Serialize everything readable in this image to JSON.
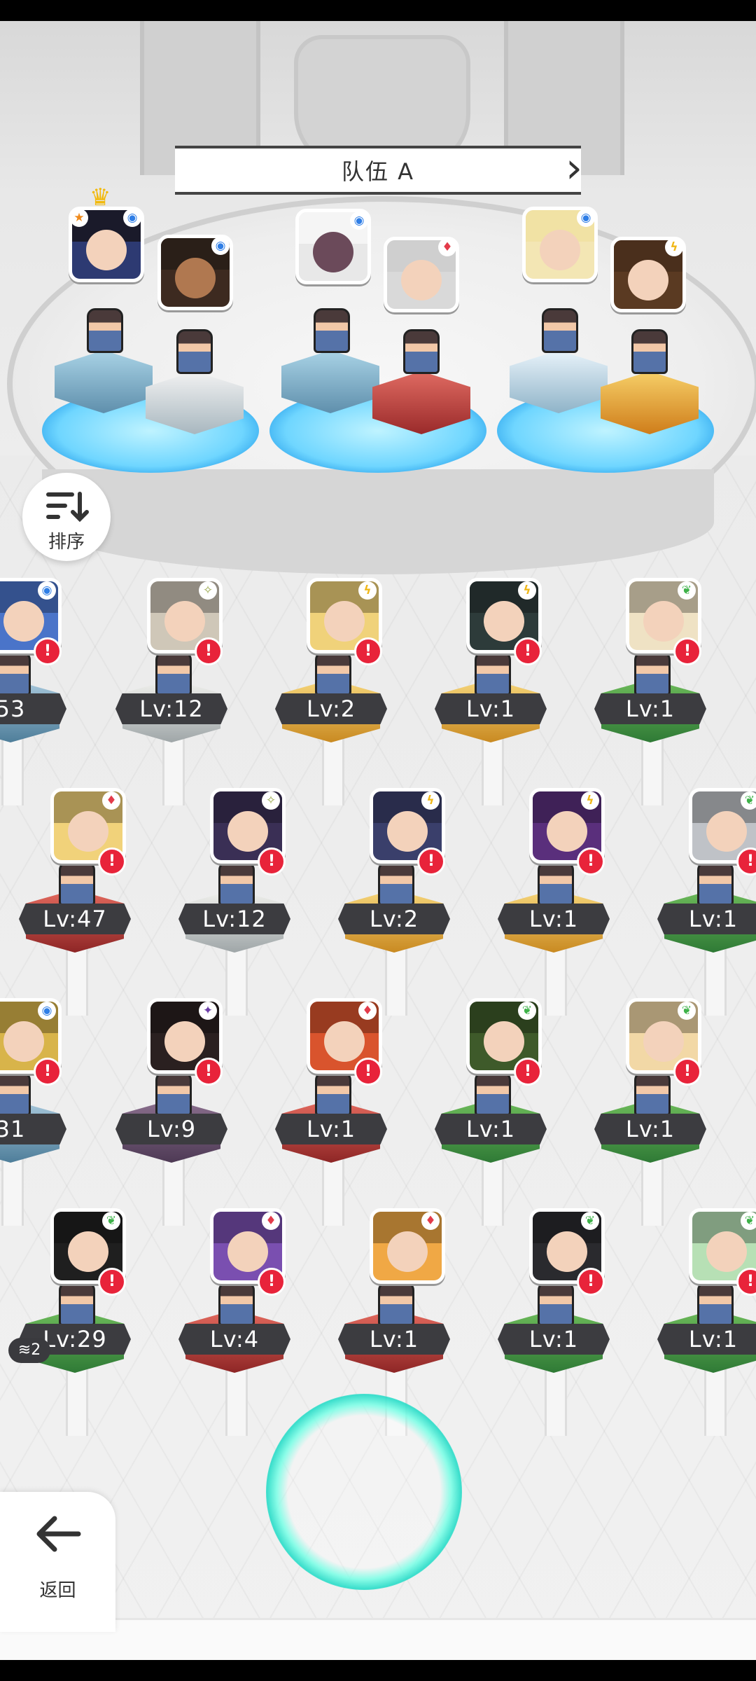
{
  "team": {
    "title": "队伍 A",
    "prev_icon": "chevron-left-icon",
    "next_icon": "chevron-right-icon"
  },
  "sort_button": {
    "label": "排序",
    "icon": "sort-descending-icon"
  },
  "back_button": {
    "label": "返回",
    "icon": "arrow-left-icon"
  },
  "stack_badge": {
    "count": "2"
  },
  "colors": {
    "alert": "#e8233a",
    "level_plate": "#3c3c40",
    "slot_glow": "#6fd6ff"
  },
  "hero_rows": [
    [
      {
        "level": "53",
        "element": "water",
        "color": "#4a74c9"
      },
      {
        "level": "Lv:12",
        "element": "light",
        "color": "#cfc7b8"
      },
      {
        "level": "Lv:2",
        "element": "thunder",
        "color": "#f0d27a"
      },
      {
        "level": "Lv:1",
        "element": "thunder",
        "color": "#2d3b3a"
      },
      {
        "level": "Lv:1",
        "element": "wood",
        "color": "#efe2c4"
      }
    ],
    [
      {
        "level": "Lv:47",
        "element": "fire",
        "color": "#f1d27a"
      },
      {
        "level": "Lv:12",
        "element": "light",
        "color": "#3a2f55"
      },
      {
        "level": "Lv:2",
        "element": "thunder",
        "color": "#3a3f6b"
      },
      {
        "level": "Lv:1",
        "element": "thunder",
        "color": "#5a2f7c"
      },
      {
        "level": "Lv:1",
        "element": "wood",
        "color": "#bfc2c7"
      }
    ],
    [
      {
        "level": "31",
        "element": "water",
        "color": "#d8b44a"
      },
      {
        "level": "Lv:9",
        "element": "dark",
        "color": "#2a2020"
      },
      {
        "level": "Lv:1",
        "element": "fire",
        "color": "#d9542d"
      },
      {
        "level": "Lv:1",
        "element": "wood",
        "color": "#3e5a2a"
      },
      {
        "level": "Lv:1",
        "element": "wood",
        "color": "#f2d8a6"
      }
    ],
    [
      {
        "level": "Lv:29",
        "element": "wood",
        "color": "#1f1f1f"
      },
      {
        "level": "Lv:4",
        "element": "fire",
        "color": "#7a4fb0"
      },
      {
        "level": "Lv:1",
        "element": "fire",
        "color": "#f0a845"
      },
      {
        "level": "Lv:1",
        "element": "wood",
        "color": "#2a2a2e"
      },
      {
        "level": "Lv:1",
        "element": "wood",
        "color": "#b7e0b5"
      }
    ]
  ]
}
